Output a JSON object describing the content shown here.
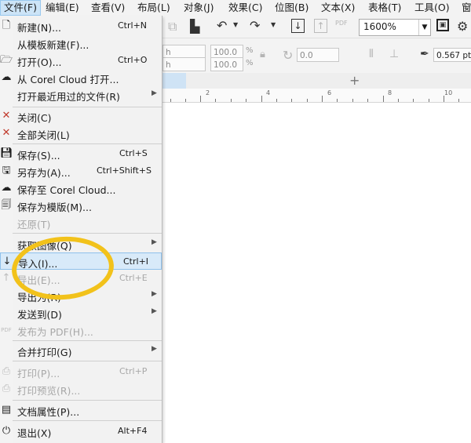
{
  "menubar": {
    "items": [
      "文件(F)",
      "编辑(E)",
      "查看(V)",
      "布局(L)",
      "对象(J)",
      "效果(C)",
      "位图(B)",
      "文本(X)",
      "表格(T)",
      "工具(O)",
      "窗"
    ]
  },
  "toolbar": {
    "zoom_value": "1600%",
    "scale_x": "100.0",
    "scale_y": "100.0",
    "unit_percent": "%",
    "rotation": "0.0",
    "outline_width": "0.567 pt",
    "pdf_label": "PDF"
  },
  "ruler": {
    "ticks": [
      "2",
      "4",
      "6",
      "8",
      "10"
    ]
  },
  "file_menu": {
    "items": [
      {
        "label": "新建(N)...",
        "shortcut": "Ctrl+N"
      },
      {
        "label": "从模板新建(F)...",
        "shortcut": ""
      },
      {
        "label": "打开(O)...",
        "shortcut": "Ctrl+O"
      },
      {
        "label": "从 Corel Cloud 打开...",
        "shortcut": ""
      },
      {
        "label": "打开最近用过的文件(R)",
        "shortcut": ""
      },
      {
        "label": "关闭(C)",
        "shortcut": ""
      },
      {
        "label": "全部关闭(L)",
        "shortcut": ""
      },
      {
        "label": "保存(S)...",
        "shortcut": "Ctrl+S"
      },
      {
        "label": "另存为(A)...",
        "shortcut": "Ctrl+Shift+S"
      },
      {
        "label": "保存至 Corel Cloud...",
        "shortcut": ""
      },
      {
        "label": "保存为模版(M)...",
        "shortcut": ""
      },
      {
        "label": "还原(T)",
        "shortcut": ""
      },
      {
        "label": "获取图像(Q)",
        "shortcut": ""
      },
      {
        "label": "导入(I)...",
        "shortcut": "Ctrl+I"
      },
      {
        "label": "导出(E)...",
        "shortcut": "Ctrl+E"
      },
      {
        "label": "导出为(R)",
        "shortcut": ""
      },
      {
        "label": "发送到(D)",
        "shortcut": ""
      },
      {
        "label": "发布为 PDF(H)...",
        "shortcut": ""
      },
      {
        "label": "合并打印(G)",
        "shortcut": ""
      },
      {
        "label": "打印(P)...",
        "shortcut": "Ctrl+P"
      },
      {
        "label": "打印预览(R)...",
        "shortcut": ""
      },
      {
        "label": "文档属性(P)...",
        "shortcut": ""
      },
      {
        "label": "退出(X)",
        "shortcut": "Alt+F4"
      }
    ]
  }
}
